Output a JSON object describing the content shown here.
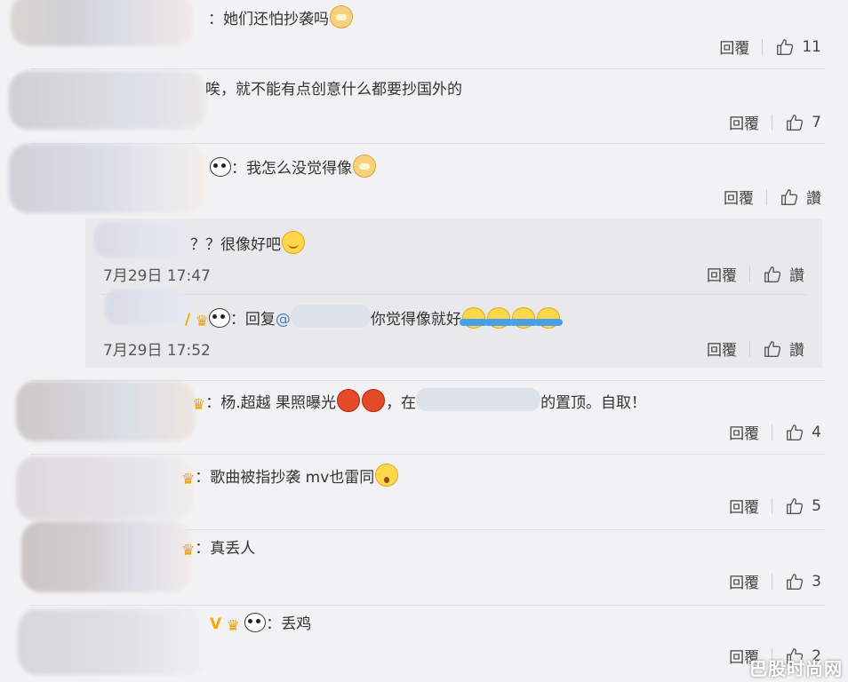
{
  "comments": [
    {
      "text": "：她们还怕抄袭吗",
      "reply": "回覆",
      "likes": "11"
    },
    {
      "text": "唉，就不能有点创意什么都要抄国外的",
      "reply": "回覆",
      "likes": "7"
    },
    {
      "text": "：我怎么没觉得像",
      "reply": "回覆",
      "likes": "讚"
    },
    {
      "text": "：杨.超越 果照曝光",
      "text2": "，在",
      "text3": "的置顶。自取！",
      "reply": "回覆",
      "likes": "4"
    },
    {
      "text": "：歌曲被指抄袭 mv也雷同",
      "reply": "回覆",
      "likes": "5"
    },
    {
      "text": "：真丢人",
      "reply": "回覆",
      "likes": "3"
    },
    {
      "text": "：丢鸡",
      "reply": "回覆",
      "likes": "2"
    }
  ],
  "subreplies": [
    {
      "text": "？？很像好吧",
      "time": "7月29日 17:47",
      "reply": "回覆",
      "likes": "讚"
    },
    {
      "text_prefix": "：回复",
      "mention": "@",
      "text": "你觉得像就好",
      "time": "7月29日 17:52",
      "reply": "回覆",
      "likes": "讚"
    }
  ],
  "watermark": "巴股时尚网"
}
